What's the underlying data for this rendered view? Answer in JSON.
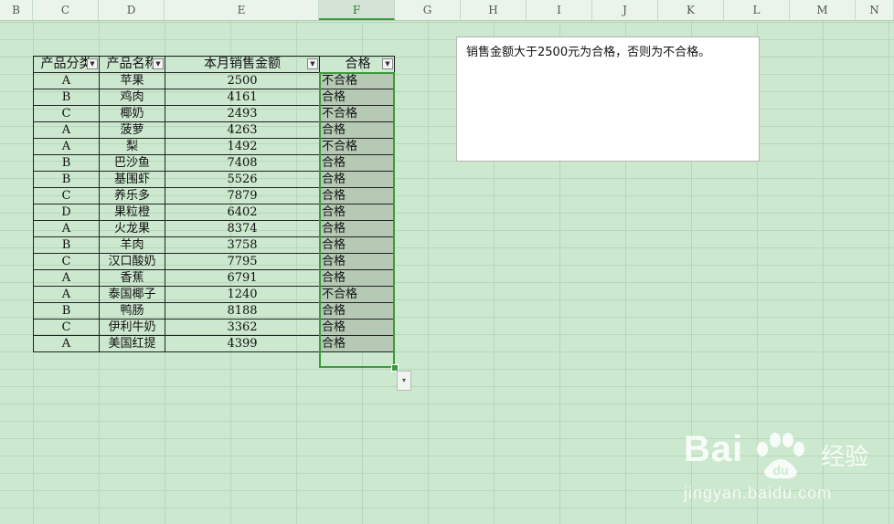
{
  "columns": [
    "B",
    "C",
    "D",
    "E",
    "F",
    "G",
    "H",
    "I",
    "J",
    "K",
    "L",
    "M",
    "N"
  ],
  "active_column": "F",
  "table": {
    "headers": {
      "category": "产品分类",
      "name": "产品名称",
      "sales": "本月销售金额",
      "result": "合格"
    },
    "rows": [
      {
        "category": "A",
        "name": "苹果",
        "sales": "2500",
        "result": "不合格"
      },
      {
        "category": "B",
        "name": "鸡肉",
        "sales": "4161",
        "result": "合格"
      },
      {
        "category": "C",
        "name": "椰奶",
        "sales": "2493",
        "result": "不合格"
      },
      {
        "category": "A",
        "name": "菠萝",
        "sales": "4263",
        "result": "合格"
      },
      {
        "category": "A",
        "name": "梨",
        "sales": "1492",
        "result": "不合格"
      },
      {
        "category": "B",
        "name": "巴沙鱼",
        "sales": "7408",
        "result": "合格"
      },
      {
        "category": "B",
        "name": "基围虾",
        "sales": "5526",
        "result": "合格"
      },
      {
        "category": "C",
        "name": "养乐多",
        "sales": "7879",
        "result": "合格"
      },
      {
        "category": "D",
        "name": "果粒橙",
        "sales": "6402",
        "result": "合格"
      },
      {
        "category": "A",
        "name": "火龙果",
        "sales": "8374",
        "result": "合格"
      },
      {
        "category": "B",
        "name": "羊肉",
        "sales": "3758",
        "result": "合格"
      },
      {
        "category": "C",
        "name": "汉口酸奶",
        "sales": "7795",
        "result": "合格"
      },
      {
        "category": "A",
        "name": "香蕉",
        "sales": "6791",
        "result": "合格"
      },
      {
        "category": "A",
        "name": "泰国椰子",
        "sales": "1240",
        "result": "不合格"
      },
      {
        "category": "B",
        "name": "鸭肠",
        "sales": "8188",
        "result": "合格"
      },
      {
        "category": "C",
        "name": "伊利牛奶",
        "sales": "3362",
        "result": "合格"
      },
      {
        "category": "A",
        "name": "美国红提",
        "sales": "4399",
        "result": "合格"
      }
    ]
  },
  "note": "销售金额大于2500元为合格，否则为不合格。",
  "watermark": {
    "logo": "Bai du",
    "cn": "经验",
    "url": "jingyan.baidu.com"
  }
}
